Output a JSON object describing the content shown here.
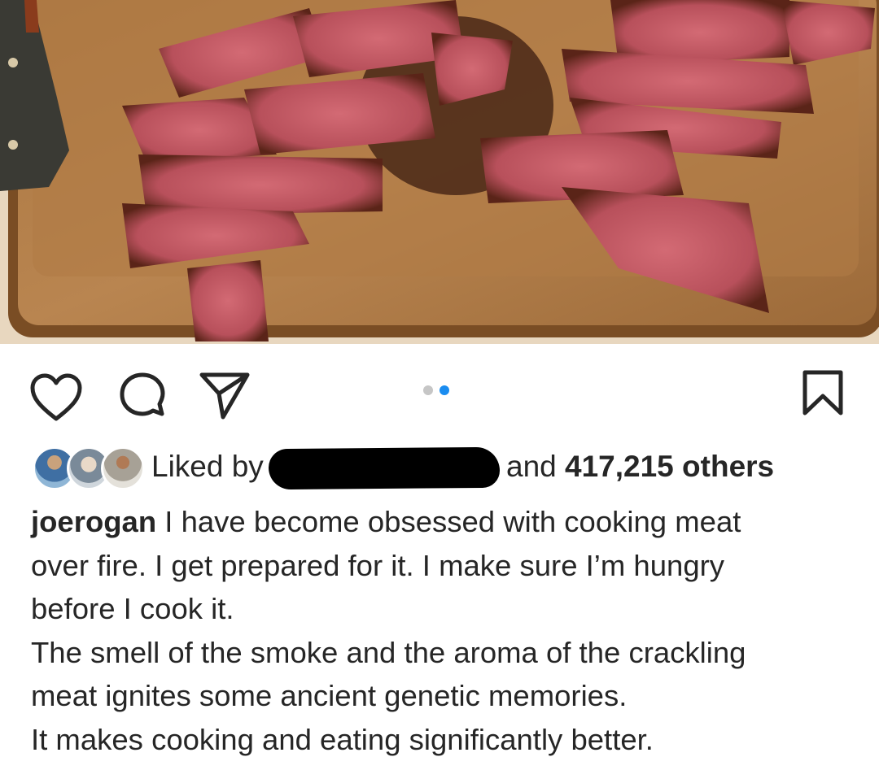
{
  "post": {
    "image_alt": "Sliced steak on a wooden cutting board",
    "carousel": {
      "count": 2,
      "active_index": 1
    }
  },
  "actions": {
    "like_icon": "heart-icon",
    "comment_icon": "comment-bubble-icon",
    "share_icon": "paper-plane-icon",
    "save_icon": "bookmark-icon"
  },
  "likes": {
    "prefix": "Liked by",
    "connector": "and",
    "count_text": "417,215 others"
  },
  "caption": {
    "username": "joerogan",
    "line1_text": " I have become obsessed with cooking meat",
    "line2": "over fire.  I get prepared for it.  I make sure I’m hungry",
    "line3": "before I cook it.",
    "line4": "The smell of the smoke and the aroma of the crackling",
    "line5": "meat ignites some ancient genetic memories.",
    "line6": "It makes cooking and eating significantly better."
  },
  "colors": {
    "text": "#262626",
    "dot_active": "#1a8cf0",
    "dot_inactive": "#c6c6c6"
  }
}
